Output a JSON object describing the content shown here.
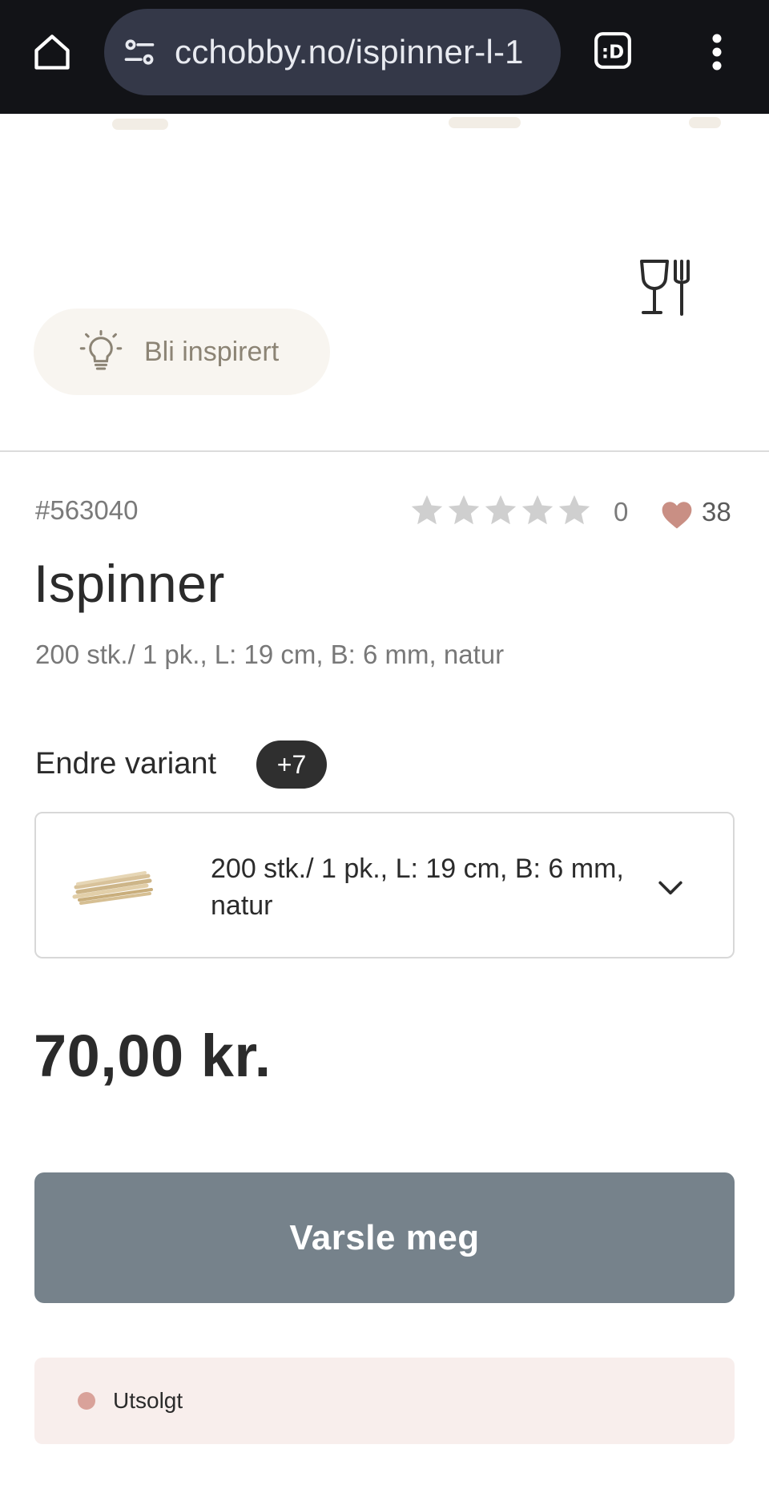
{
  "browser": {
    "url": "cchobby.no/ispinner-l-1",
    "home_icon": "home-icon",
    "site_info_icon": "tune-icon",
    "extension_icon": "extension-d-icon",
    "menu_icon": "more-vert-icon"
  },
  "product": {
    "inspire_label": "Bli inspirert",
    "sku": "#563040",
    "rating_count": "0",
    "rating_stars": 0,
    "favorites_count": "38",
    "title": "Ispinner",
    "subtitle": "200 stk./ 1 pk., L: 19 cm, B: 6 mm, natur",
    "variant_label": "Endre variant",
    "variant_badge": "+7",
    "selected_variant": "200 stk./ 1 pk., L: 19 cm, B: 6 mm, natur",
    "price": "70,00 kr.",
    "notify_button": "Varsle meg",
    "stock_status": "Utsolgt"
  },
  "colors": {
    "browser_bar": "#121317",
    "url_pill": "#343848",
    "button": "#76828b",
    "status_bg": "#f8eeec",
    "status_dot": "#d9a29a",
    "heart": "#c98f84"
  }
}
